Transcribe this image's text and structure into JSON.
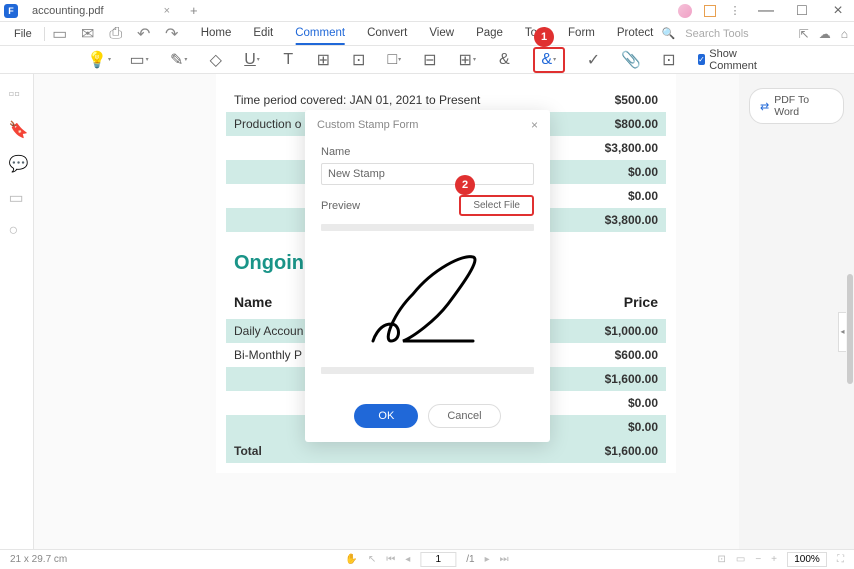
{
  "titlebar": {
    "filename": "accounting.pdf",
    "app_icon": "F"
  },
  "menubar": {
    "file": "File",
    "tabs": [
      "Home",
      "Edit",
      "Comment",
      "Convert",
      "View",
      "Page",
      "Tool",
      "Form",
      "Protect"
    ],
    "active_index": 2,
    "search_placeholder": "Search Tools"
  },
  "toolbar": {
    "show_comment": "Show Comment"
  },
  "right": {
    "pdf_to_word": "PDF To Word"
  },
  "doc": {
    "rows_top": [
      {
        "label": "Time period covered: JAN 01, 2021 to Present",
        "price": "$500.00",
        "shaded": false
      },
      {
        "label": "Production o",
        "price": "$800.00",
        "shaded": true
      },
      {
        "label": "",
        "price": "$3,800.00",
        "shaded": false
      },
      {
        "label": "",
        "price": "$0.00",
        "shaded": true
      },
      {
        "label": "",
        "price": "$0.00",
        "shaded": false
      },
      {
        "label": "",
        "price": "$3,800.00",
        "shaded": true
      }
    ],
    "section_title": "Ongoin",
    "header_name": "Name",
    "header_price": "Price",
    "rows_bottom": [
      {
        "label": "Daily Accoun",
        "price": "$1,000.00",
        "shaded": true
      },
      {
        "label": "Bi-Monthly P",
        "price": "$600.00",
        "shaded": false
      },
      {
        "label": "",
        "price": "$1,600.00",
        "shaded": true
      },
      {
        "label": "",
        "price": "$0.00",
        "shaded": false
      },
      {
        "label": "",
        "price": "$0.00",
        "shaded": true
      },
      {
        "label": "Total",
        "price": "$1,600.00",
        "shaded": true,
        "bold": true
      }
    ]
  },
  "dialog": {
    "title": "Custom Stamp Form",
    "name_label": "Name",
    "name_value": "New Stamp",
    "preview_label": "Preview",
    "select_file": "Select File",
    "ok": "OK",
    "cancel": "Cancel"
  },
  "badges": {
    "one": "1",
    "two": "2"
  },
  "statusbar": {
    "dimensions": "21 x 29.7 cm",
    "page": "1",
    "total": "/1",
    "zoom": "100%"
  }
}
